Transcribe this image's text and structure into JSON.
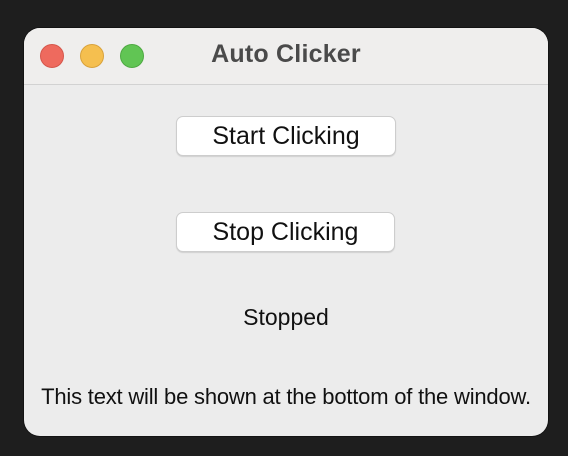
{
  "window": {
    "title": "Auto Clicker"
  },
  "buttons": {
    "start_label": "Start Clicking",
    "stop_label": "Stop Clicking"
  },
  "status": {
    "text": "Stopped"
  },
  "footer": {
    "text": "This text will be shown at the bottom of the window."
  },
  "colors": {
    "close": "#ee6a5e",
    "minimize": "#f5bf4f",
    "zoom": "#61c554",
    "window_background": "#ececec",
    "desktop_background": "#1e1e1e"
  },
  "icons": [
    "close-window-icon",
    "minimize-window-icon",
    "zoom-window-icon"
  ]
}
